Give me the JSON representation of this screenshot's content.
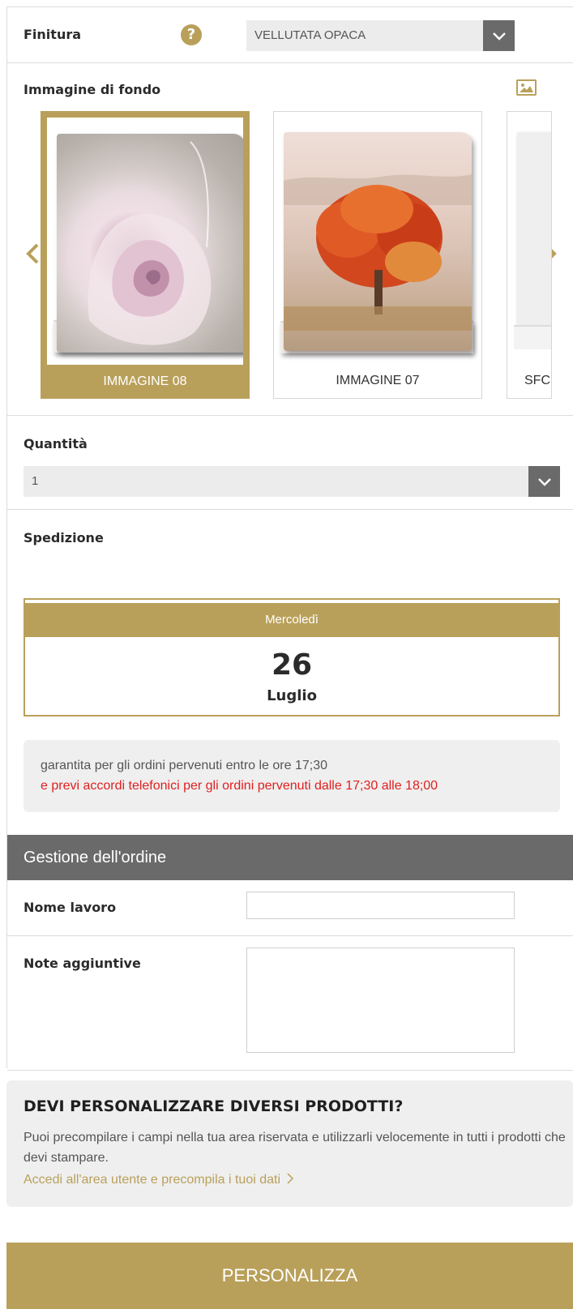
{
  "finitura": {
    "label": "Finitura",
    "help_icon": "question-circle-icon",
    "help_glyph": "?",
    "selected": "VELLUTATA OPACA"
  },
  "background_image": {
    "label": "Immagine di fondo",
    "items": [
      {
        "caption": "IMMAGINE 08",
        "selected": true,
        "image": "pink-rose"
      },
      {
        "caption": "IMMAGINE 07",
        "selected": false,
        "image": "red-autumn-tree"
      },
      {
        "caption": "SFC",
        "selected": false,
        "image": "partial"
      }
    ]
  },
  "quantity": {
    "label": "Quantità",
    "selected": "1"
  },
  "shipping": {
    "label": "Spedizione",
    "weekday": "Mercoledì",
    "day": "26",
    "month": "Luglio",
    "note_line1": "garantita per gli ordini pervenuti entro le ore 17;30",
    "note_line2": "e previ accordi telefonici per gli ordini pervenuti dalle 17;30 alle 18;00"
  },
  "order": {
    "title": "Gestione dell'ordine",
    "job_name_label": "Nome lavoro",
    "job_name_value": "",
    "notes_label": "Note aggiuntive",
    "notes_value": ""
  },
  "promo": {
    "title": "DEVI PERSONALIZZARE DIVERSI PRODOTTI?",
    "description": "Puoi precompilare i campi nella tua area riservata e utilizzarli velocemente in tutti i prodotti che devi stampare.",
    "link": "Accedi all'area utente e precompila i tuoi dati"
  },
  "cta_label": "PERSONALIZZA",
  "colors": {
    "accent_gold": "#b9a05a",
    "dark_gray": "#6a6a6a",
    "warning_red": "#e02020"
  }
}
